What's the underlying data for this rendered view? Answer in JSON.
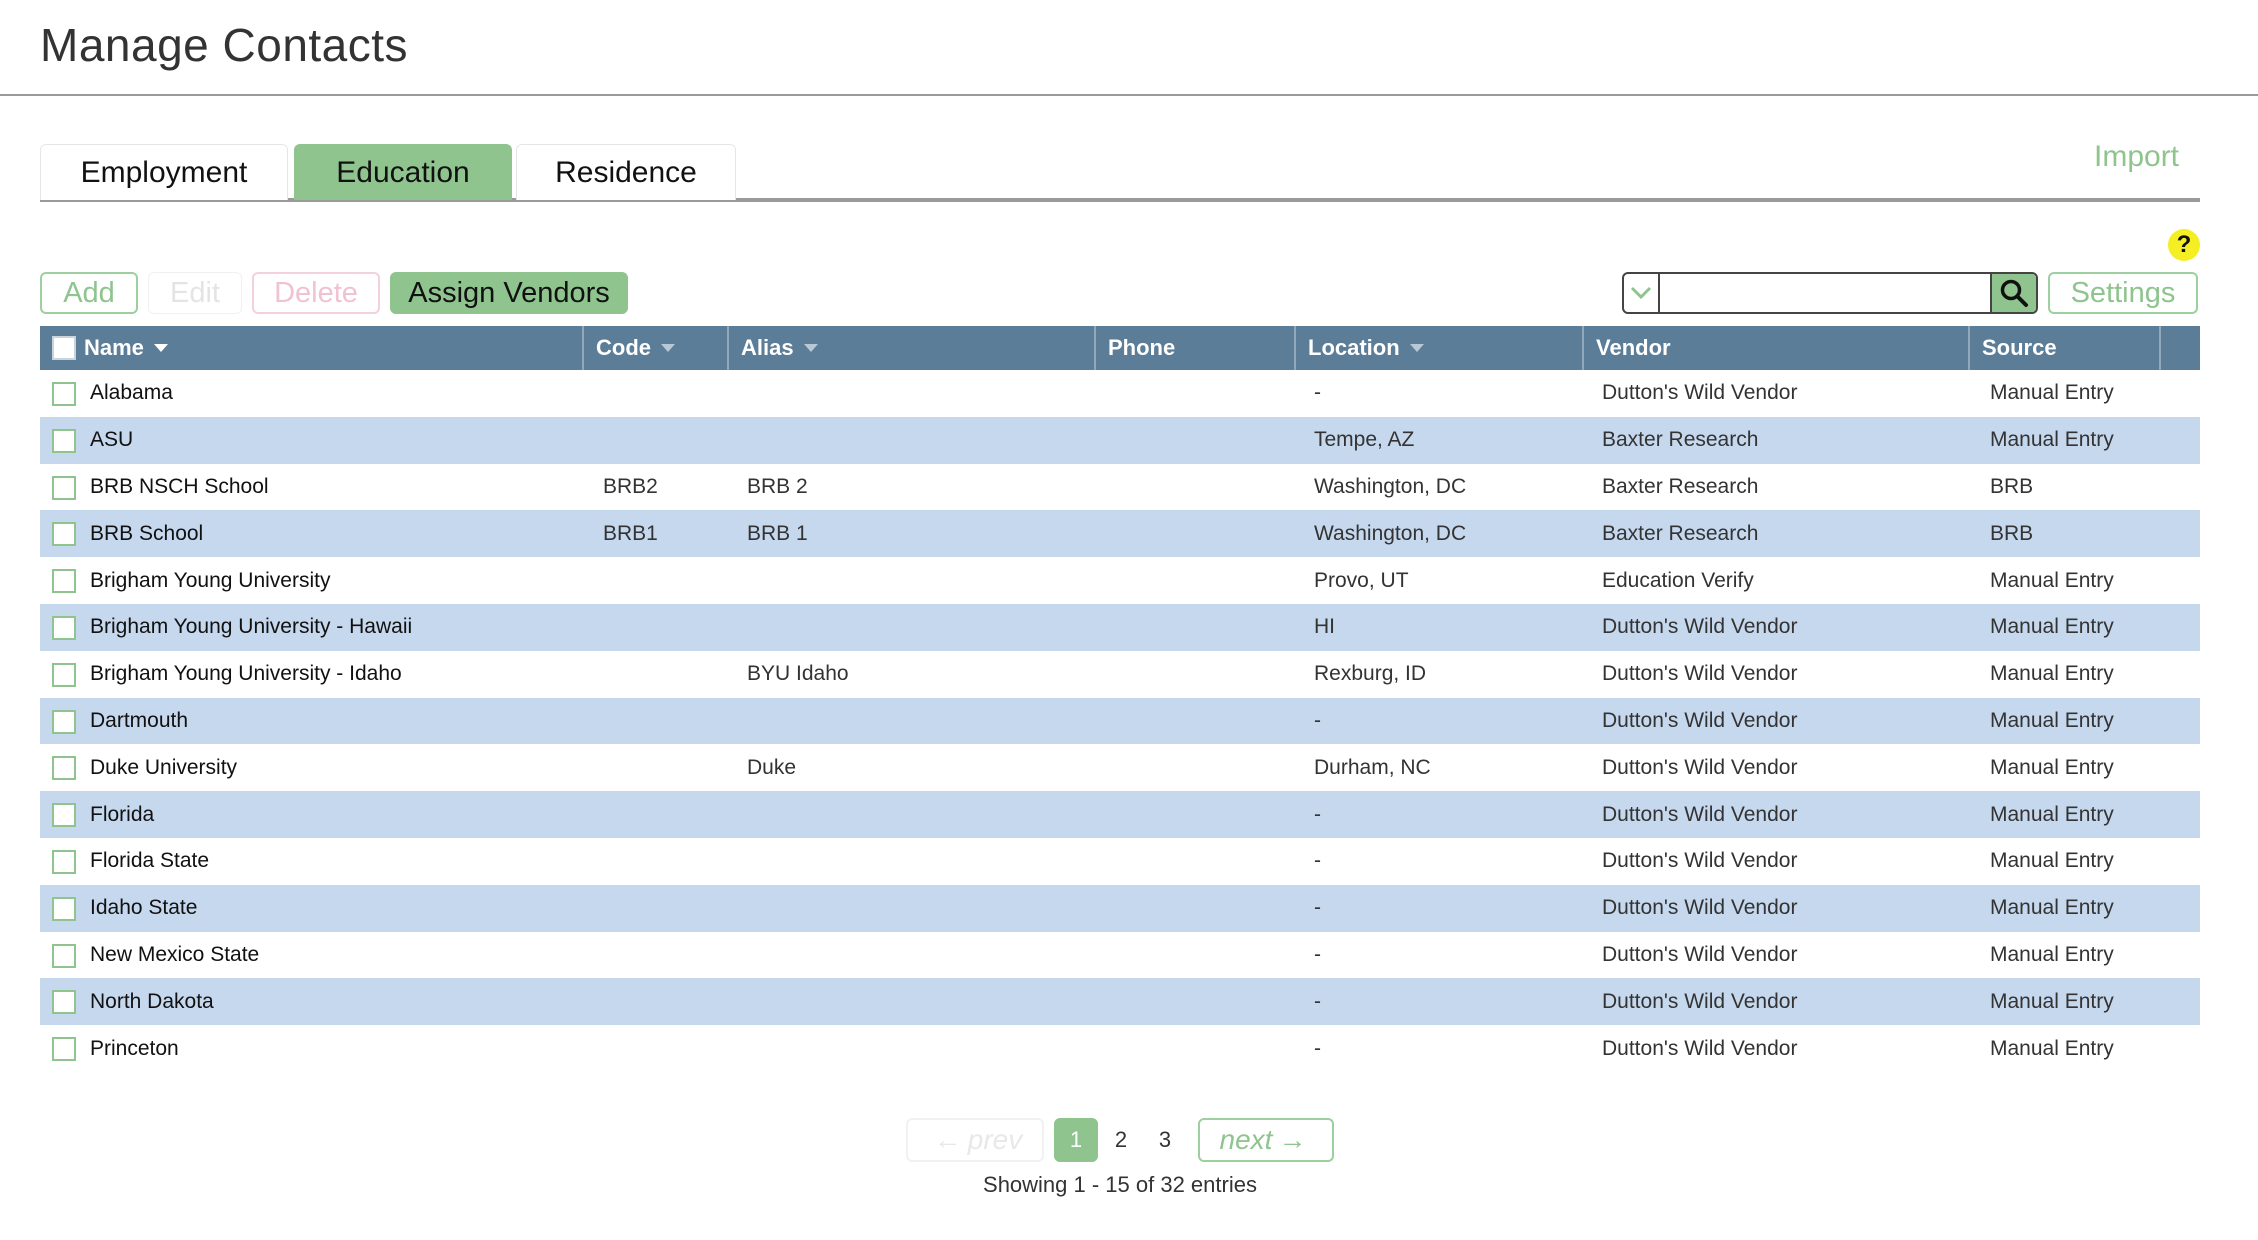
{
  "page": {
    "title": "Manage Contacts"
  },
  "tabs": [
    {
      "label": "Employment",
      "active": false
    },
    {
      "label": "Education",
      "active": true
    },
    {
      "label": "Residence",
      "active": false
    }
  ],
  "import_label": "Import",
  "help_label": "?",
  "toolbar": {
    "add_label": "Add",
    "edit_label": "Edit",
    "delete_label": "Delete",
    "assign_label": "Assign Vendors",
    "settings_label": "Settings",
    "search_value": "",
    "search_placeholder": ""
  },
  "columns": [
    {
      "label": "Name",
      "sortable": true
    },
    {
      "label": "Code",
      "sortable": true
    },
    {
      "label": "Alias",
      "sortable": true
    },
    {
      "label": "Phone",
      "sortable": false
    },
    {
      "label": "Location",
      "sortable": true
    },
    {
      "label": "Vendor",
      "sortable": false
    },
    {
      "label": "Source",
      "sortable": false
    }
  ],
  "rows": [
    {
      "name": "Alabama",
      "code": "",
      "alias": "",
      "phone": "",
      "location": "-",
      "vendor": "Dutton's Wild Vendor",
      "source": "Manual Entry"
    },
    {
      "name": "ASU",
      "code": "",
      "alias": "",
      "phone": "",
      "location": "Tempe, AZ",
      "vendor": "Baxter Research",
      "source": "Manual Entry"
    },
    {
      "name": "BRB NSCH School",
      "code": "BRB2",
      "alias": "BRB 2",
      "phone": "",
      "location": "Washington, DC",
      "vendor": "Baxter Research",
      "source": "BRB"
    },
    {
      "name": "BRB School",
      "code": "BRB1",
      "alias": "BRB 1",
      "phone": "",
      "location": "Washington, DC",
      "vendor": "Baxter Research",
      "source": "BRB"
    },
    {
      "name": "Brigham Young University",
      "code": "",
      "alias": "",
      "phone": "",
      "location": "Provo, UT",
      "vendor": "Education Verify",
      "source": "Manual Entry"
    },
    {
      "name": "Brigham Young University - Hawaii",
      "code": "",
      "alias": "",
      "phone": "",
      "location": "HI",
      "vendor": "Dutton's Wild Vendor",
      "source": "Manual Entry"
    },
    {
      "name": "Brigham Young University - Idaho",
      "code": "",
      "alias": "BYU Idaho",
      "phone": "",
      "location": "Rexburg, ID",
      "vendor": "Dutton's Wild Vendor",
      "source": "Manual Entry"
    },
    {
      "name": "Dartmouth",
      "code": "",
      "alias": "",
      "phone": "",
      "location": "-",
      "vendor": "Dutton's Wild Vendor",
      "source": "Manual Entry"
    },
    {
      "name": "Duke University",
      "code": "",
      "alias": "Duke",
      "phone": "",
      "location": "Durham, NC",
      "vendor": "Dutton's Wild Vendor",
      "source": "Manual Entry"
    },
    {
      "name": "Florida",
      "code": "",
      "alias": "",
      "phone": "",
      "location": "-",
      "vendor": "Dutton's Wild Vendor",
      "source": "Manual Entry"
    },
    {
      "name": "Florida State",
      "code": "",
      "alias": "",
      "phone": "",
      "location": "-",
      "vendor": "Dutton's Wild Vendor",
      "source": "Manual Entry"
    },
    {
      "name": "Idaho State",
      "code": "",
      "alias": "",
      "phone": "",
      "location": "-",
      "vendor": "Dutton's Wild Vendor",
      "source": "Manual Entry"
    },
    {
      "name": "New Mexico State",
      "code": "",
      "alias": "",
      "phone": "",
      "location": "-",
      "vendor": "Dutton's Wild Vendor",
      "source": "Manual Entry"
    },
    {
      "name": "North Dakota",
      "code": "",
      "alias": "",
      "phone": "",
      "location": "-",
      "vendor": "Dutton's Wild Vendor",
      "source": "Manual Entry"
    },
    {
      "name": "Princeton",
      "code": "",
      "alias": "",
      "phone": "",
      "location": "-",
      "vendor": "Dutton's Wild Vendor",
      "source": "Manual Entry"
    }
  ],
  "pagination": {
    "prev_label": "prev",
    "next_label": "next",
    "pages": [
      "1",
      "2",
      "3"
    ],
    "current_page": "1",
    "summary": "Showing 1 - 15 of 32 entries"
  },
  "colors": {
    "accent_green": "#8fc48f",
    "header_blue": "#5b7d98",
    "row_alt_blue": "#c6d8ee",
    "help_yellow": "#f4ee22"
  }
}
